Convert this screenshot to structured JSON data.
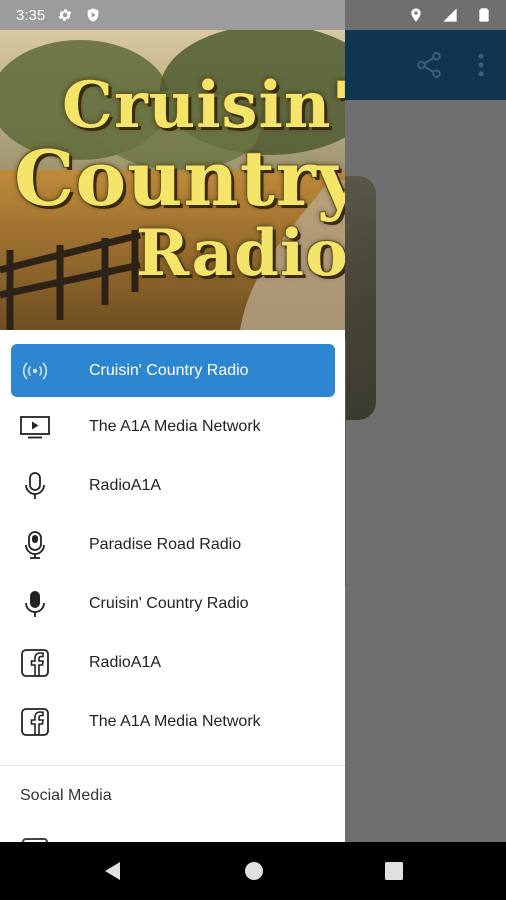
{
  "status_bar": {
    "time": "3:35",
    "icons": [
      "settings-icon",
      "shield-icon",
      "location-icon",
      "signal-icon",
      "battery-icon"
    ]
  },
  "header": {
    "logo_text": [
      "Cruisin'",
      "Country",
      "Radio"
    ]
  },
  "menu": {
    "items": [
      {
        "label": "Cruisin' Country Radio",
        "icon": "radio-broadcast-icon",
        "active": true
      },
      {
        "label": "The A1A Media Network",
        "icon": "tv-play-icon",
        "active": false
      },
      {
        "label": "RadioA1A",
        "icon": "microphone-outline-icon",
        "active": false
      },
      {
        "label": "Paradise Road Radio",
        "icon": "podcast-mic-icon",
        "active": false
      },
      {
        "label": "Cruisin' Country Radio",
        "icon": "microphone-icon",
        "active": false
      },
      {
        "label": "RadioA1A",
        "icon": "facebook-icon",
        "active": false
      },
      {
        "label": "The A1A Media Network",
        "icon": "facebook-icon",
        "active": false
      }
    ]
  },
  "section": {
    "title": "Social Media"
  },
  "colors": {
    "accent": "#2e86d0",
    "app_bar": "#0f3550",
    "logo_text": "#f4e56a"
  },
  "nav_bar": {
    "buttons": [
      "back-icon",
      "home-icon",
      "recents-icon"
    ]
  }
}
